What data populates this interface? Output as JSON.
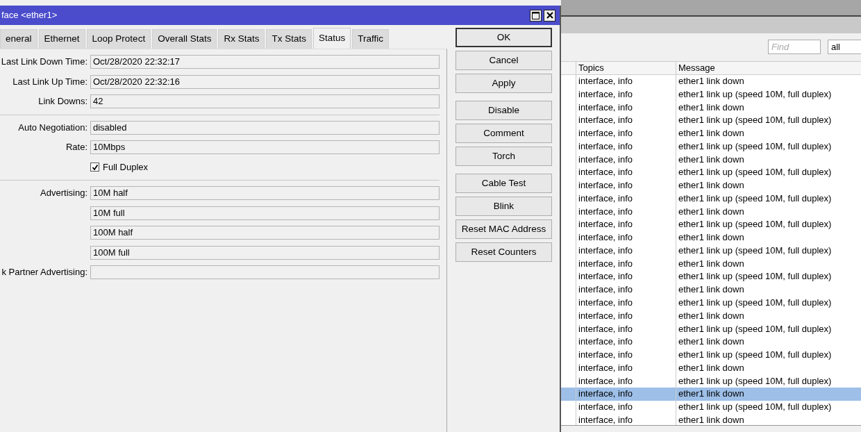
{
  "dialog": {
    "title": "face <ether1>",
    "tabs": [
      {
        "label": "eneral",
        "selected": false
      },
      {
        "label": "Ethernet",
        "selected": false
      },
      {
        "label": "Loop Protect",
        "selected": false
      },
      {
        "label": "Overall Stats",
        "selected": false
      },
      {
        "label": "Rx Stats",
        "selected": false
      },
      {
        "label": "Tx Stats",
        "selected": false
      },
      {
        "label": "Status",
        "selected": true
      },
      {
        "label": "Traffic",
        "selected": false
      }
    ],
    "fields": [
      {
        "kind": "field",
        "label": "Last Link Down Time:",
        "value": "Oct/28/2020 22:32:17"
      },
      {
        "kind": "field",
        "label": "Last Link Up Time:",
        "value": "Oct/28/2020 22:32:16"
      },
      {
        "kind": "field",
        "label": "Link Downs:",
        "value": "42"
      },
      {
        "kind": "separator"
      },
      {
        "kind": "field",
        "label": "Auto Negotiation:",
        "value": "disabled"
      },
      {
        "kind": "field",
        "label": "Rate:",
        "value": "10Mbps"
      },
      {
        "kind": "checkbox",
        "label": "Full Duplex",
        "checked": true
      },
      {
        "kind": "separator"
      },
      {
        "kind": "field",
        "label": "Advertising:",
        "value": "10M half"
      },
      {
        "kind": "field",
        "value": "10M full"
      },
      {
        "kind": "field",
        "value": "100M half"
      },
      {
        "kind": "field",
        "value": "100M full"
      },
      {
        "kind": "field",
        "label": "k Partner Advertising:"
      }
    ],
    "button_groups": [
      [
        {
          "label": "OK",
          "default": true
        },
        {
          "label": "Cancel",
          "default": false
        },
        {
          "label": "Apply",
          "default": false
        }
      ],
      [
        {
          "label": "Disable",
          "default": false
        },
        {
          "label": "Comment",
          "default": false
        },
        {
          "label": "Torch",
          "default": false
        }
      ],
      [
        {
          "label": "Cable Test",
          "default": false
        },
        {
          "label": "Blink",
          "default": false
        },
        {
          "label": "Reset MAC Address",
          "default": false
        },
        {
          "label": "Reset Counters",
          "default": false
        }
      ]
    ]
  },
  "log": {
    "find": {
      "placeholder": "Find"
    },
    "filter": "all",
    "columns": [
      "Topics",
      "Message"
    ],
    "rows": [
      {
        "topics": "interface, info",
        "message": "ether1 link down",
        "selected": false
      },
      {
        "topics": "interface, info",
        "message": "ether1 link up (speed 10M, full duplex)",
        "selected": false
      },
      {
        "topics": "interface, info",
        "message": "ether1 link down",
        "selected": false
      },
      {
        "topics": "interface, info",
        "message": "ether1 link up (speed 10M, full duplex)",
        "selected": false
      },
      {
        "topics": "interface, info",
        "message": "ether1 link down",
        "selected": false
      },
      {
        "topics": "interface, info",
        "message": "ether1 link up (speed 10M, full duplex)",
        "selected": false
      },
      {
        "topics": "interface, info",
        "message": "ether1 link down",
        "selected": false
      },
      {
        "topics": "interface, info",
        "message": "ether1 link up (speed 10M, full duplex)",
        "selected": false
      },
      {
        "topics": "interface, info",
        "message": "ether1 link down",
        "selected": false
      },
      {
        "topics": "interface, info",
        "message": "ether1 link up (speed 10M, full duplex)",
        "selected": false
      },
      {
        "topics": "interface, info",
        "message": "ether1 link down",
        "selected": false
      },
      {
        "topics": "interface, info",
        "message": "ether1 link up (speed 10M, full duplex)",
        "selected": false
      },
      {
        "topics": "interface, info",
        "message": "ether1 link down",
        "selected": false
      },
      {
        "topics": "interface, info",
        "message": "ether1 link up (speed 10M, full duplex)",
        "selected": false
      },
      {
        "topics": "interface, info",
        "message": "ether1 link down",
        "selected": false
      },
      {
        "topics": "interface, info",
        "message": "ether1 link up (speed 10M, full duplex)",
        "selected": false
      },
      {
        "topics": "interface, info",
        "message": "ether1 link down",
        "selected": false
      },
      {
        "topics": "interface, info",
        "message": "ether1 link up (speed 10M, full duplex)",
        "selected": false
      },
      {
        "topics": "interface, info",
        "message": "ether1 link down",
        "selected": false
      },
      {
        "topics": "interface, info",
        "message": "ether1 link up (speed 10M, full duplex)",
        "selected": false
      },
      {
        "topics": "interface, info",
        "message": "ether1 link down",
        "selected": false
      },
      {
        "topics": "interface, info",
        "message": "ether1 link up (speed 10M, full duplex)",
        "selected": false
      },
      {
        "topics": "interface, info",
        "message": "ether1 link down",
        "selected": false
      },
      {
        "topics": "interface, info",
        "message": "ether1 link up (speed 10M, full duplex)",
        "selected": false
      },
      {
        "topics": "interface, info",
        "message": "ether1 link down",
        "selected": true
      },
      {
        "topics": "interface, info",
        "message": "ether1 link up (speed 10M, full duplex)",
        "selected": false
      },
      {
        "topics": "interface, info",
        "message": "ether1 link down",
        "selected": false
      }
    ]
  }
}
